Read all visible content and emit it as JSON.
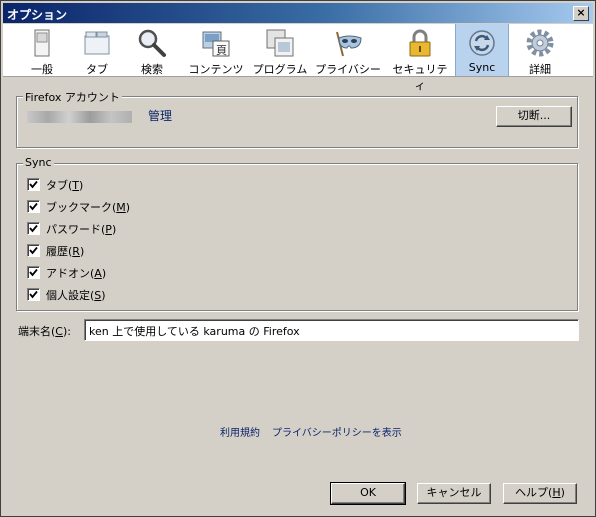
{
  "window": {
    "title": "オプション",
    "close_label": "×"
  },
  "toolbar": {
    "items": [
      {
        "label": "一般",
        "icon": "general-icon"
      },
      {
        "label": "タブ",
        "icon": "tabs-icon"
      },
      {
        "label": "検索",
        "icon": "search-icon"
      },
      {
        "label": "コンテンツ",
        "icon": "content-icon"
      },
      {
        "label": "プログラム",
        "icon": "applications-icon"
      },
      {
        "label": "プライバシー",
        "icon": "privacy-mask-icon"
      },
      {
        "label": "セキュリティ",
        "icon": "security-lock-icon"
      },
      {
        "label": "Sync",
        "icon": "sync-icon",
        "selected": true
      },
      {
        "label": "詳細",
        "icon": "advanced-gear-icon"
      }
    ]
  },
  "account": {
    "legend": "Firefox アカウント",
    "manage_label": "管理",
    "disconnect_label": "切断..."
  },
  "sync": {
    "legend": "Sync",
    "items": [
      {
        "label": "タブ(",
        "key": "T",
        "checked": true
      },
      {
        "label": "ブックマーク(",
        "key": "M",
        "checked": true
      },
      {
        "label": "パスワード(",
        "key": "P",
        "checked": true
      },
      {
        "label": "履歴(",
        "key": "R",
        "checked": true
      },
      {
        "label": "アドオン(",
        "key": "A",
        "checked": true
      },
      {
        "label": "個人設定(",
        "key": "S",
        "checked": true
      }
    ]
  },
  "device": {
    "label": "端末名(",
    "key": "C",
    "label_end": "):",
    "value": "ken 上で使用している karuma の Firefox"
  },
  "footer": {
    "terms_label": "利用規約",
    "privacy_label": "プライバシーポリシーを表示"
  },
  "buttons": {
    "ok_label": "OK",
    "cancel_label": "キャンセル",
    "help_label": "ヘルプ(",
    "help_key": "H",
    "help_end": ")"
  }
}
